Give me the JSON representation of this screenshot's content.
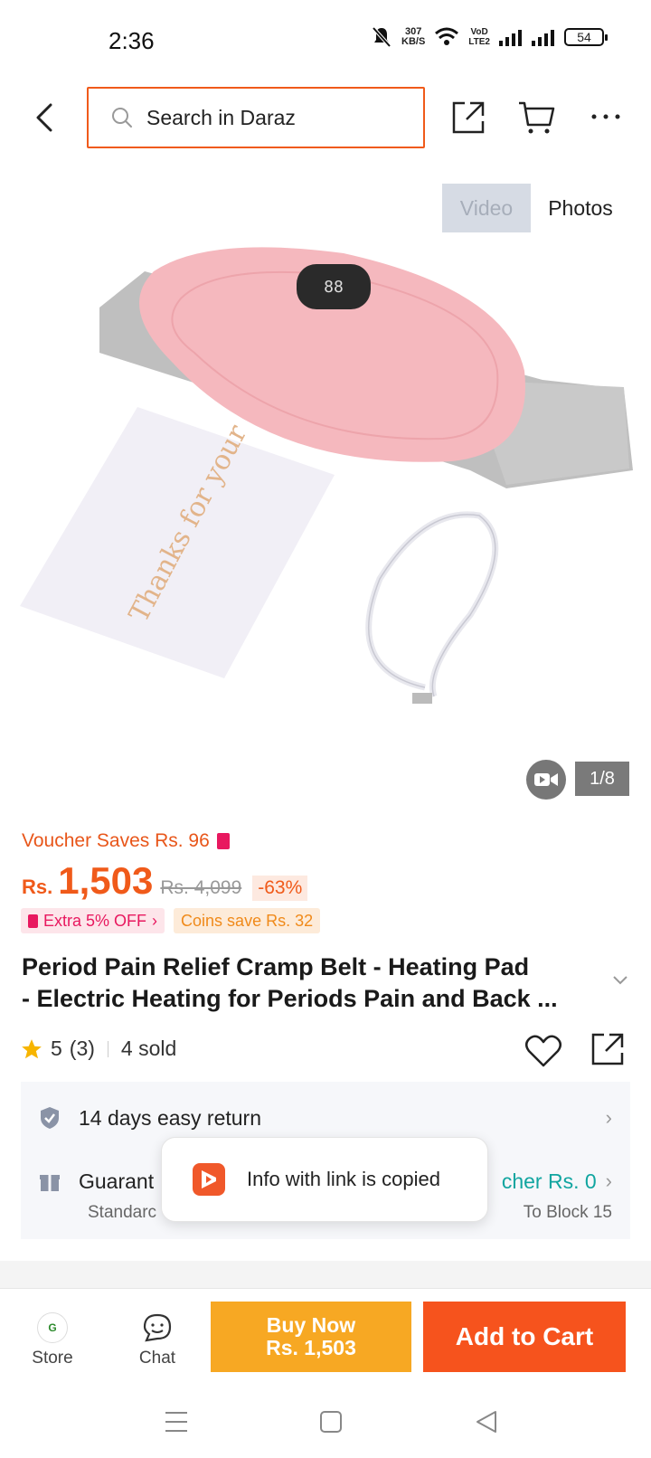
{
  "status": {
    "time": "2:36",
    "net_speed_value": "307",
    "net_speed_unit": "KB/S",
    "volte": "VoD\nLTE2",
    "battery": "54"
  },
  "header": {
    "search_placeholder": "Search in Daraz"
  },
  "media": {
    "tab_video": "Video",
    "tab_photos": "Photos",
    "counter": "1/8"
  },
  "product_image": {
    "card_text": "Thanks for your"
  },
  "pricing": {
    "voucher": "Voucher Saves Rs. 96",
    "currency": "Rs.",
    "price": "1,503",
    "original_price": "Rs. 4,099",
    "discount": "-63%",
    "chip_extra": "Extra 5% OFF",
    "chip_coins": "Coins save Rs. 32"
  },
  "product": {
    "title_line1": "Period Pain Relief Cramp Belt - Heating Pad",
    "title_line2": "- Electric Heating for Periods Pain and Back ..."
  },
  "stats": {
    "rating": "5",
    "reviews": "(3)",
    "sold": "4 sold"
  },
  "services": {
    "returns": "14 days easy return",
    "guarantee_partial": "Guarant",
    "voucher_partial": "cher Rs. 0",
    "delivery_partial": "Standarc",
    "block": "To Block 15"
  },
  "toast": {
    "text": "Info with link is copied"
  },
  "bottom": {
    "store_label": "Store",
    "chat_label": "Chat",
    "buy_now_line1": "Buy Now",
    "buy_now_line2": "Rs. 1,503",
    "add_to_cart": "Add to Cart"
  },
  "colors": {
    "accent": "#f05a1a",
    "buy_now": "#f7a823",
    "add_cart": "#f6531d",
    "teal": "#11a5a0"
  }
}
